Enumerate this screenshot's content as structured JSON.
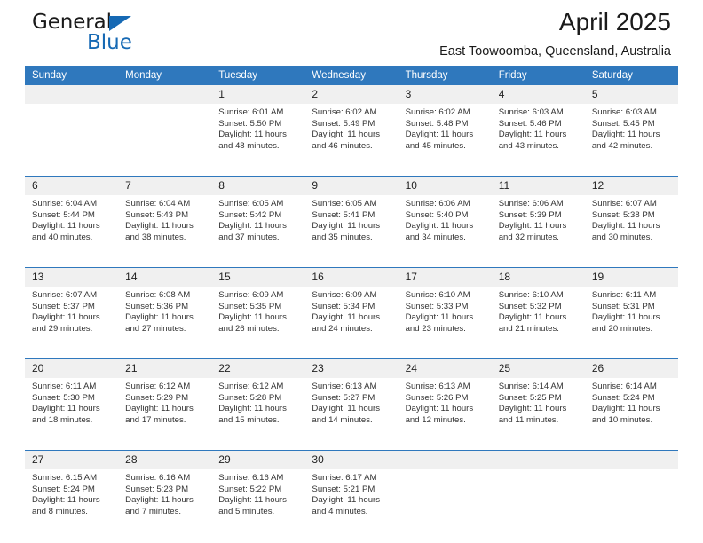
{
  "brand": {
    "name_part1": "General",
    "name_part2": "Blue",
    "logo_icon": "triangle-icon",
    "accent_color": "#1669b4"
  },
  "header": {
    "title": "April 2025",
    "subtitle": "East Toowoomba, Queensland, Australia"
  },
  "colors": {
    "header_row_bg": "#2f78bd",
    "daynum_bg": "#f0f0f0",
    "text": "#222222"
  },
  "calendar": {
    "weekday_headers": [
      "Sunday",
      "Monday",
      "Tuesday",
      "Wednesday",
      "Thursday",
      "Friday",
      "Saturday"
    ],
    "labels": {
      "sunrise": "Sunrise:",
      "sunset": "Sunset:",
      "daylight": "Daylight:"
    },
    "weeks": [
      [
        {
          "day": "",
          "lines": []
        },
        {
          "day": "",
          "lines": []
        },
        {
          "day": "1",
          "lines": [
            "Sunrise: 6:01 AM",
            "Sunset: 5:50 PM",
            "Daylight: 11 hours",
            "and 48 minutes."
          ]
        },
        {
          "day": "2",
          "lines": [
            "Sunrise: 6:02 AM",
            "Sunset: 5:49 PM",
            "Daylight: 11 hours",
            "and 46 minutes."
          ]
        },
        {
          "day": "3",
          "lines": [
            "Sunrise: 6:02 AM",
            "Sunset: 5:48 PM",
            "Daylight: 11 hours",
            "and 45 minutes."
          ]
        },
        {
          "day": "4",
          "lines": [
            "Sunrise: 6:03 AM",
            "Sunset: 5:46 PM",
            "Daylight: 11 hours",
            "and 43 minutes."
          ]
        },
        {
          "day": "5",
          "lines": [
            "Sunrise: 6:03 AM",
            "Sunset: 5:45 PM",
            "Daylight: 11 hours",
            "and 42 minutes."
          ]
        }
      ],
      [
        {
          "day": "6",
          "lines": [
            "Sunrise: 6:04 AM",
            "Sunset: 5:44 PM",
            "Daylight: 11 hours",
            "and 40 minutes."
          ]
        },
        {
          "day": "7",
          "lines": [
            "Sunrise: 6:04 AM",
            "Sunset: 5:43 PM",
            "Daylight: 11 hours",
            "and 38 minutes."
          ]
        },
        {
          "day": "8",
          "lines": [
            "Sunrise: 6:05 AM",
            "Sunset: 5:42 PM",
            "Daylight: 11 hours",
            "and 37 minutes."
          ]
        },
        {
          "day": "9",
          "lines": [
            "Sunrise: 6:05 AM",
            "Sunset: 5:41 PM",
            "Daylight: 11 hours",
            "and 35 minutes."
          ]
        },
        {
          "day": "10",
          "lines": [
            "Sunrise: 6:06 AM",
            "Sunset: 5:40 PM",
            "Daylight: 11 hours",
            "and 34 minutes."
          ]
        },
        {
          "day": "11",
          "lines": [
            "Sunrise: 6:06 AM",
            "Sunset: 5:39 PM",
            "Daylight: 11 hours",
            "and 32 minutes."
          ]
        },
        {
          "day": "12",
          "lines": [
            "Sunrise: 6:07 AM",
            "Sunset: 5:38 PM",
            "Daylight: 11 hours",
            "and 30 minutes."
          ]
        }
      ],
      [
        {
          "day": "13",
          "lines": [
            "Sunrise: 6:07 AM",
            "Sunset: 5:37 PM",
            "Daylight: 11 hours",
            "and 29 minutes."
          ]
        },
        {
          "day": "14",
          "lines": [
            "Sunrise: 6:08 AM",
            "Sunset: 5:36 PM",
            "Daylight: 11 hours",
            "and 27 minutes."
          ]
        },
        {
          "day": "15",
          "lines": [
            "Sunrise: 6:09 AM",
            "Sunset: 5:35 PM",
            "Daylight: 11 hours",
            "and 26 minutes."
          ]
        },
        {
          "day": "16",
          "lines": [
            "Sunrise: 6:09 AM",
            "Sunset: 5:34 PM",
            "Daylight: 11 hours",
            "and 24 minutes."
          ]
        },
        {
          "day": "17",
          "lines": [
            "Sunrise: 6:10 AM",
            "Sunset: 5:33 PM",
            "Daylight: 11 hours",
            "and 23 minutes."
          ]
        },
        {
          "day": "18",
          "lines": [
            "Sunrise: 6:10 AM",
            "Sunset: 5:32 PM",
            "Daylight: 11 hours",
            "and 21 minutes."
          ]
        },
        {
          "day": "19",
          "lines": [
            "Sunrise: 6:11 AM",
            "Sunset: 5:31 PM",
            "Daylight: 11 hours",
            "and 20 minutes."
          ]
        }
      ],
      [
        {
          "day": "20",
          "lines": [
            "Sunrise: 6:11 AM",
            "Sunset: 5:30 PM",
            "Daylight: 11 hours",
            "and 18 minutes."
          ]
        },
        {
          "day": "21",
          "lines": [
            "Sunrise: 6:12 AM",
            "Sunset: 5:29 PM",
            "Daylight: 11 hours",
            "and 17 minutes."
          ]
        },
        {
          "day": "22",
          "lines": [
            "Sunrise: 6:12 AM",
            "Sunset: 5:28 PM",
            "Daylight: 11 hours",
            "and 15 minutes."
          ]
        },
        {
          "day": "23",
          "lines": [
            "Sunrise: 6:13 AM",
            "Sunset: 5:27 PM",
            "Daylight: 11 hours",
            "and 14 minutes."
          ]
        },
        {
          "day": "24",
          "lines": [
            "Sunrise: 6:13 AM",
            "Sunset: 5:26 PM",
            "Daylight: 11 hours",
            "and 12 minutes."
          ]
        },
        {
          "day": "25",
          "lines": [
            "Sunrise: 6:14 AM",
            "Sunset: 5:25 PM",
            "Daylight: 11 hours",
            "and 11 minutes."
          ]
        },
        {
          "day": "26",
          "lines": [
            "Sunrise: 6:14 AM",
            "Sunset: 5:24 PM",
            "Daylight: 11 hours",
            "and 10 minutes."
          ]
        }
      ],
      [
        {
          "day": "27",
          "lines": [
            "Sunrise: 6:15 AM",
            "Sunset: 5:24 PM",
            "Daylight: 11 hours",
            "and 8 minutes."
          ]
        },
        {
          "day": "28",
          "lines": [
            "Sunrise: 6:16 AM",
            "Sunset: 5:23 PM",
            "Daylight: 11 hours",
            "and 7 minutes."
          ]
        },
        {
          "day": "29",
          "lines": [
            "Sunrise: 6:16 AM",
            "Sunset: 5:22 PM",
            "Daylight: 11 hours",
            "and 5 minutes."
          ]
        },
        {
          "day": "30",
          "lines": [
            "Sunrise: 6:17 AM",
            "Sunset: 5:21 PM",
            "Daylight: 11 hours",
            "and 4 minutes."
          ]
        },
        {
          "day": "",
          "lines": []
        },
        {
          "day": "",
          "lines": []
        },
        {
          "day": "",
          "lines": []
        }
      ]
    ]
  }
}
